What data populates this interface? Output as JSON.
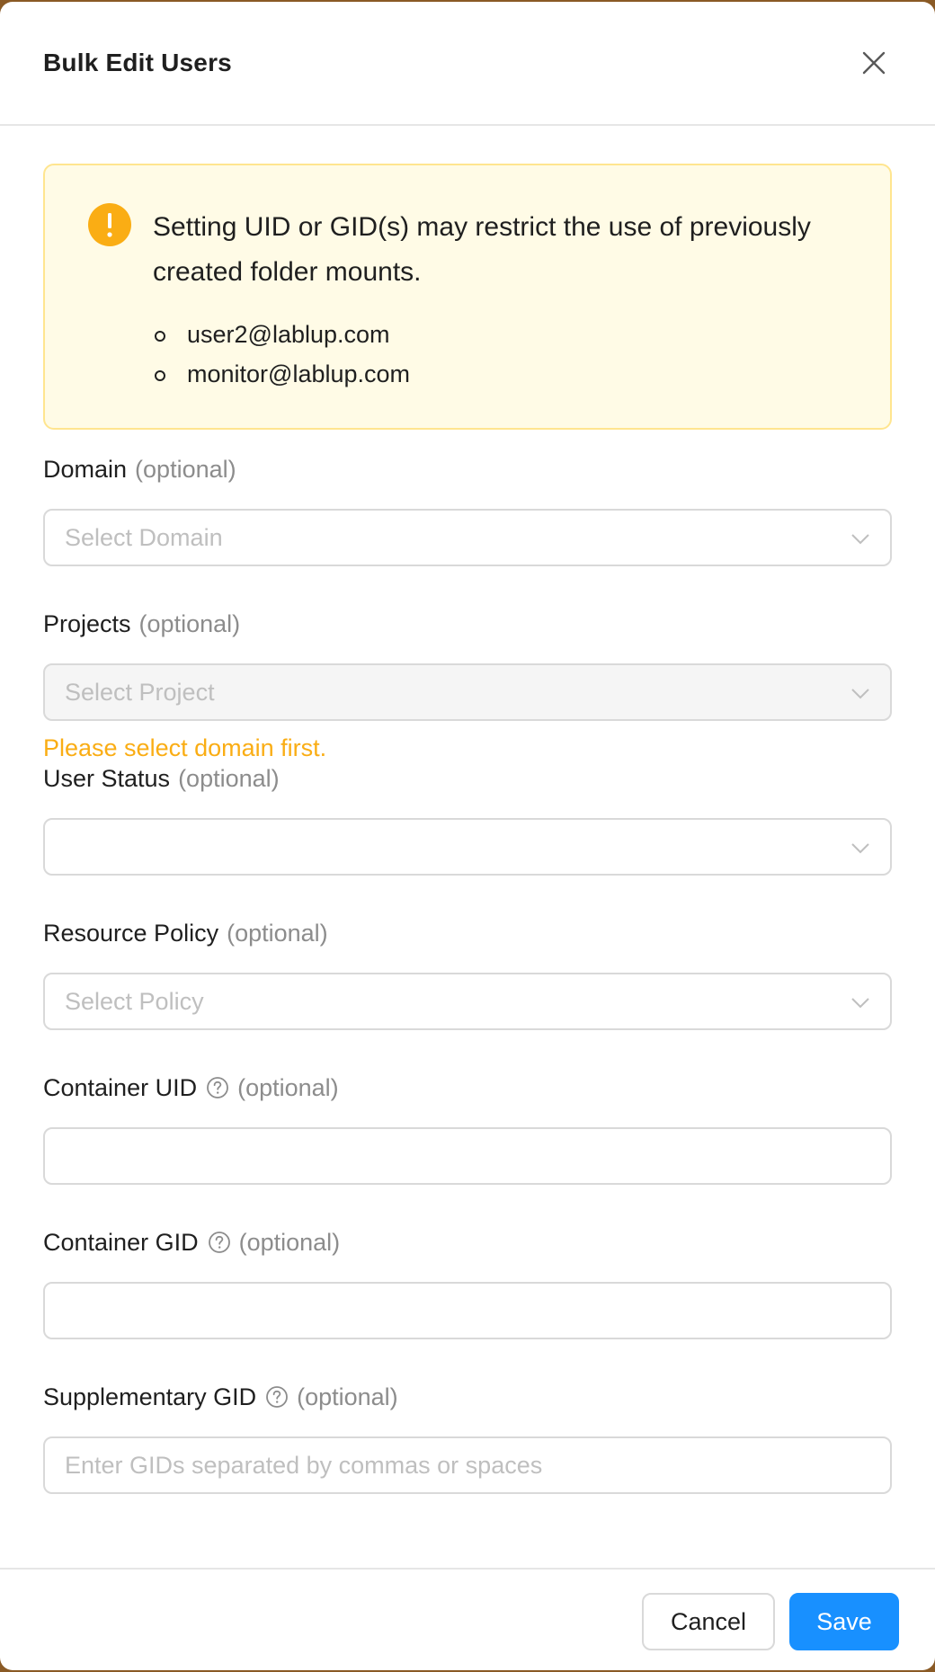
{
  "dialog": {
    "title": "Bulk Edit Users",
    "close_icon": "close-icon"
  },
  "alert": {
    "icon": "exclamation-circle-icon",
    "message": "Setting UID or GID(s) may restrict the use of previously created folder mounts.",
    "users": [
      "user2@lablup.com",
      "monitor@lablup.com"
    ]
  },
  "form": {
    "optional": "(optional)",
    "domain": {
      "label": "Domain",
      "placeholder": "Select Domain"
    },
    "projects": {
      "label": "Projects",
      "placeholder": "Select Project",
      "hint": "Please select domain first."
    },
    "user_status": {
      "label": "User Status",
      "value": ""
    },
    "resource_policy": {
      "label": "Resource Policy",
      "placeholder": "Select Policy"
    },
    "container_uid": {
      "label": "Container UID",
      "value": ""
    },
    "container_gid": {
      "label": "Container GID",
      "value": ""
    },
    "supplementary_gid": {
      "label": "Supplementary GID",
      "placeholder": "Enter GIDs separated by commas or spaces"
    }
  },
  "footer": {
    "cancel_label": "Cancel",
    "save_label": "Save"
  },
  "colors": {
    "primary": "#1890ff",
    "warning": "#faad14",
    "alert_bg": "#fffbe6",
    "alert_border": "#ffe58f"
  }
}
